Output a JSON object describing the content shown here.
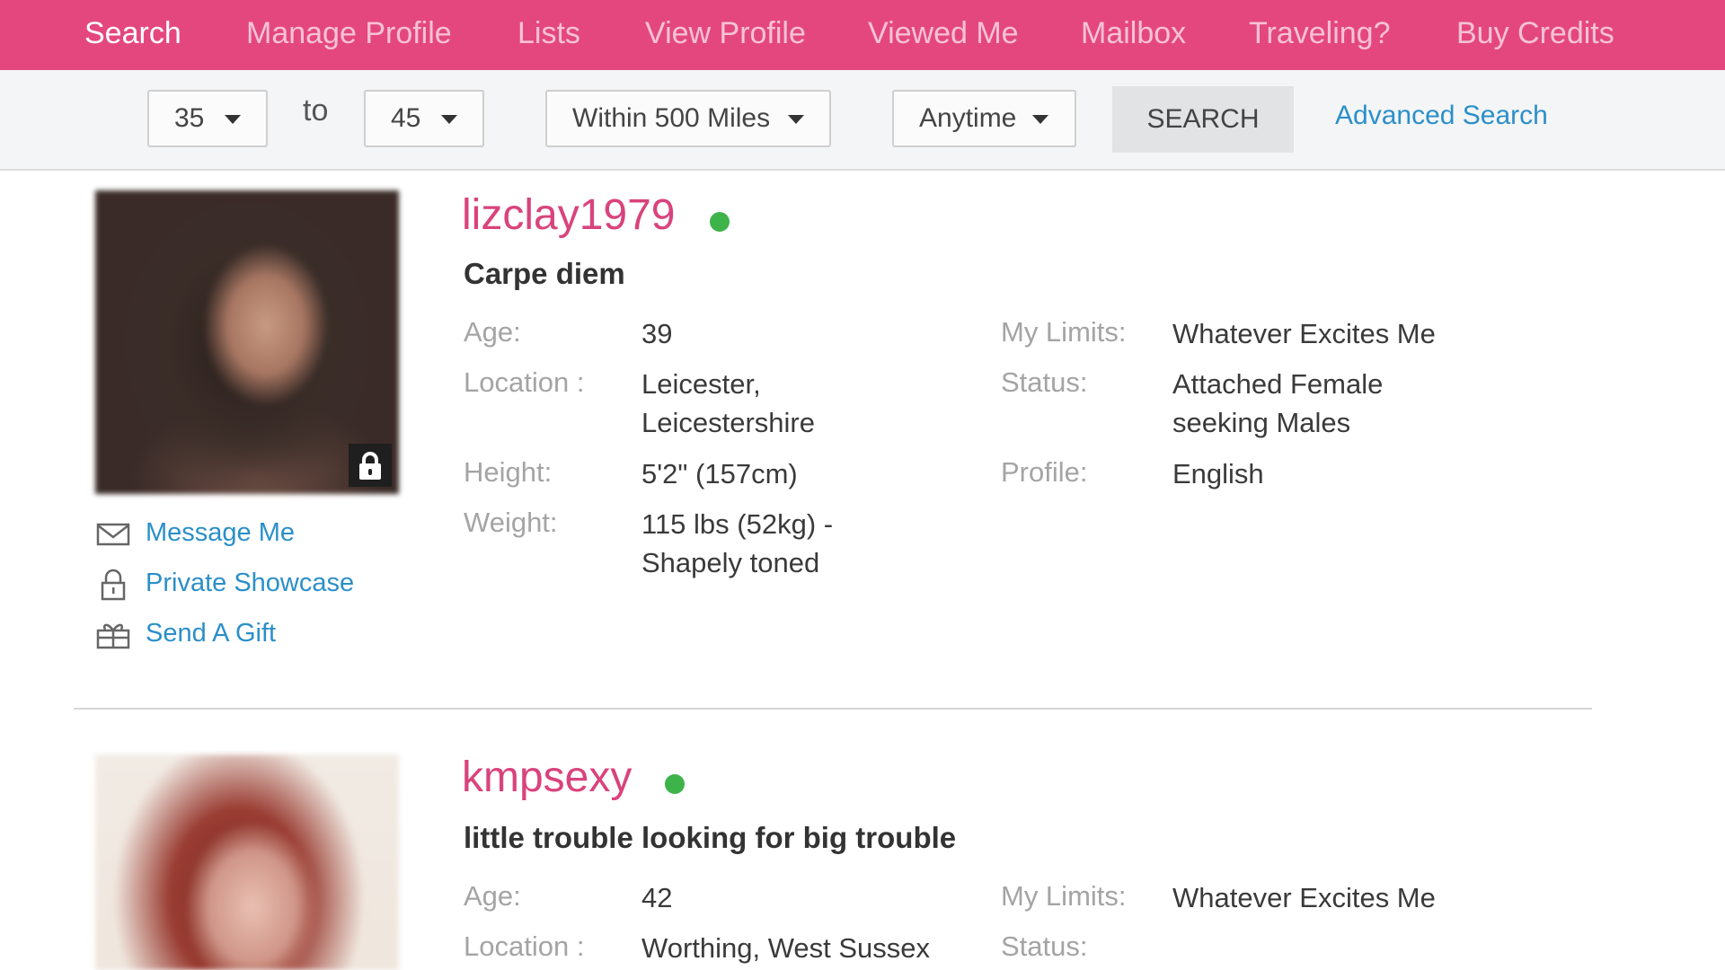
{
  "nav": {
    "items": [
      {
        "label": "Search",
        "active": true
      },
      {
        "label": "Manage Profile"
      },
      {
        "label": "Lists"
      },
      {
        "label": "View Profile"
      },
      {
        "label": "Viewed Me"
      },
      {
        "label": "Mailbox"
      },
      {
        "label": "Traveling?"
      },
      {
        "label": "Buy Credits"
      }
    ]
  },
  "filters": {
    "age_min": "35",
    "to_label": "to",
    "age_max": "45",
    "distance": "Within 500 Miles",
    "time": "Anytime",
    "search_button": "SEARCH",
    "advanced_link": "Advanced Search"
  },
  "profiles": [
    {
      "username": "lizclay1979",
      "online": true,
      "tagline": "Carpe diem",
      "photo_locked": true,
      "actions": {
        "message": "Message Me",
        "showcase": "Private Showcase",
        "gift": "Send A Gift"
      },
      "labels": {
        "age": "Age:",
        "location": "Location :",
        "height": "Height:",
        "weight": "Weight:",
        "limits": "My Limits:",
        "status": "Status:",
        "profile": "Profile:"
      },
      "age": "39",
      "location": "Leicester, Leicestershire",
      "height": "5'2\" (157cm)",
      "weight": "115 lbs (52kg) - Shapely toned",
      "limits": "Whatever Excites Me",
      "status": "Attached Female seeking Males",
      "profile_lang": "English"
    },
    {
      "username": "kmpsexy",
      "online": true,
      "tagline": "little trouble looking for big trouble",
      "labels": {
        "age": "Age:",
        "location": "Location :",
        "limits": "My Limits:",
        "status": "Status:"
      },
      "age": "42",
      "location": "Worthing, West Sussex",
      "limits": "Whatever Excites Me"
    }
  ],
  "colors": {
    "brand": "#e4477e",
    "username": "#d9437c",
    "link": "#2b8fc9",
    "online": "#3db34a"
  }
}
